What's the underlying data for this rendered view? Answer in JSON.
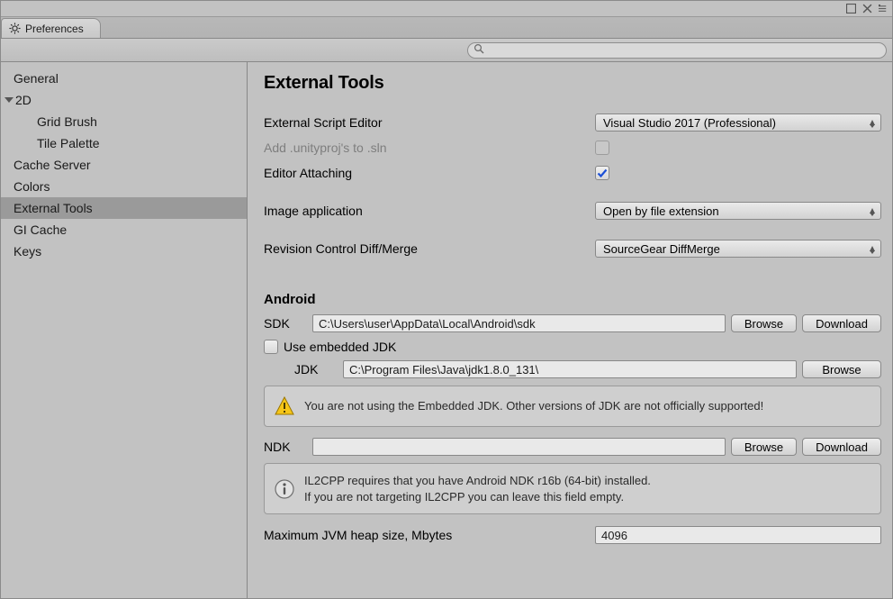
{
  "titlebar": {
    "tab_label": "Preferences"
  },
  "search": {
    "placeholder": ""
  },
  "sidebar": {
    "items": [
      {
        "label": "General"
      },
      {
        "label": "2D"
      },
      {
        "label": "Grid Brush"
      },
      {
        "label": "Tile Palette"
      },
      {
        "label": "Cache Server"
      },
      {
        "label": "Colors"
      },
      {
        "label": "External Tools"
      },
      {
        "label": "GI Cache"
      },
      {
        "label": "Keys"
      }
    ]
  },
  "page": {
    "title": "External Tools",
    "ext_editor_lbl": "External Script Editor",
    "ext_editor_val": "Visual Studio 2017 (Professional)",
    "add_proj_lbl": "Add .unityproj's to .sln",
    "editor_attach_lbl": "Editor Attaching",
    "image_app_lbl": "Image application",
    "image_app_val": "Open by file extension",
    "rev_lbl": "Revision Control Diff/Merge",
    "rev_val": "SourceGear DiffMerge",
    "android_title": "Android",
    "sdk_lbl": "SDK",
    "sdk_val": "C:\\Users\\user\\AppData\\Local\\Android\\sdk",
    "browse": "Browse",
    "download": "Download",
    "embedded_jdk_lbl": "Use embedded JDK",
    "jdk_lbl": "JDK",
    "jdk_val": "C:\\Program Files\\Java\\jdk1.8.0_131\\",
    "jdk_warn": "You are not using the Embedded JDK. Other versions of JDK are not officially supported!",
    "ndk_lbl": "NDK",
    "ndk_val": "",
    "il2cpp_l1": "IL2CPP requires that you have Android NDK r16b (64-bit) installed.",
    "il2cpp_l2": "If you are not targeting IL2CPP you can leave this field empty.",
    "heap_lbl": "Maximum JVM heap size, Mbytes",
    "heap_val": "4096"
  }
}
